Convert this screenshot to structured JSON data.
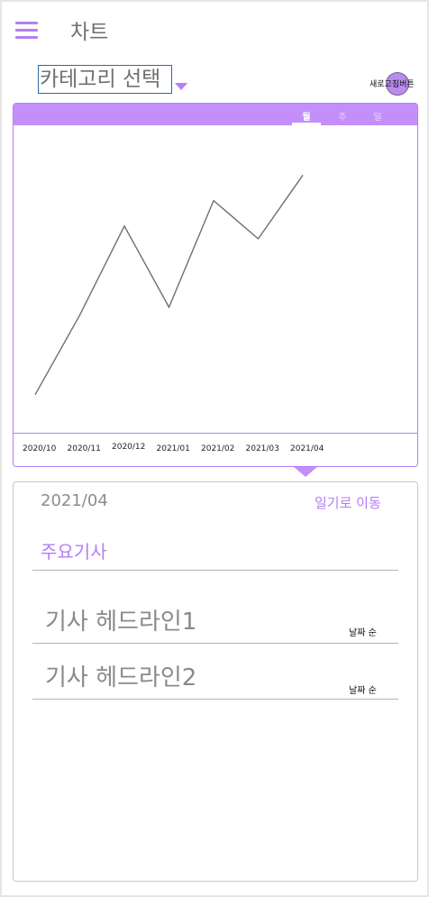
{
  "header": {
    "title": "차트",
    "menu_icon": "menu-icon"
  },
  "category": {
    "label": "카테고리 선택"
  },
  "refresh": {
    "label": "새로고침버튼"
  },
  "chart": {
    "tabs": [
      {
        "label": "월"
      },
      {
        "label": "주"
      },
      {
        "label": "일"
      }
    ],
    "active_tab": "월",
    "accent_color": "#c48ffa"
  },
  "chart_data": {
    "type": "line",
    "categories": [
      "2020/10",
      "2020/11",
      "2020/12",
      "2021/01",
      "2021/02",
      "2021/03",
      "2021/04"
    ],
    "series": [
      {
        "values": [
          12,
          62,
          118,
          67,
          134,
          110,
          150
        ]
      }
    ],
    "ylim": [
      0,
      170
    ],
    "grid": false
  },
  "news": {
    "date": "2021/04",
    "diary_link": "일기로 이동",
    "section_title": "주요기사",
    "items": [
      {
        "headline": "기사 헤드라인1",
        "sort": "날짜 순"
      },
      {
        "headline": "기사 헤드라인2",
        "sort": "날짜 순"
      }
    ]
  }
}
